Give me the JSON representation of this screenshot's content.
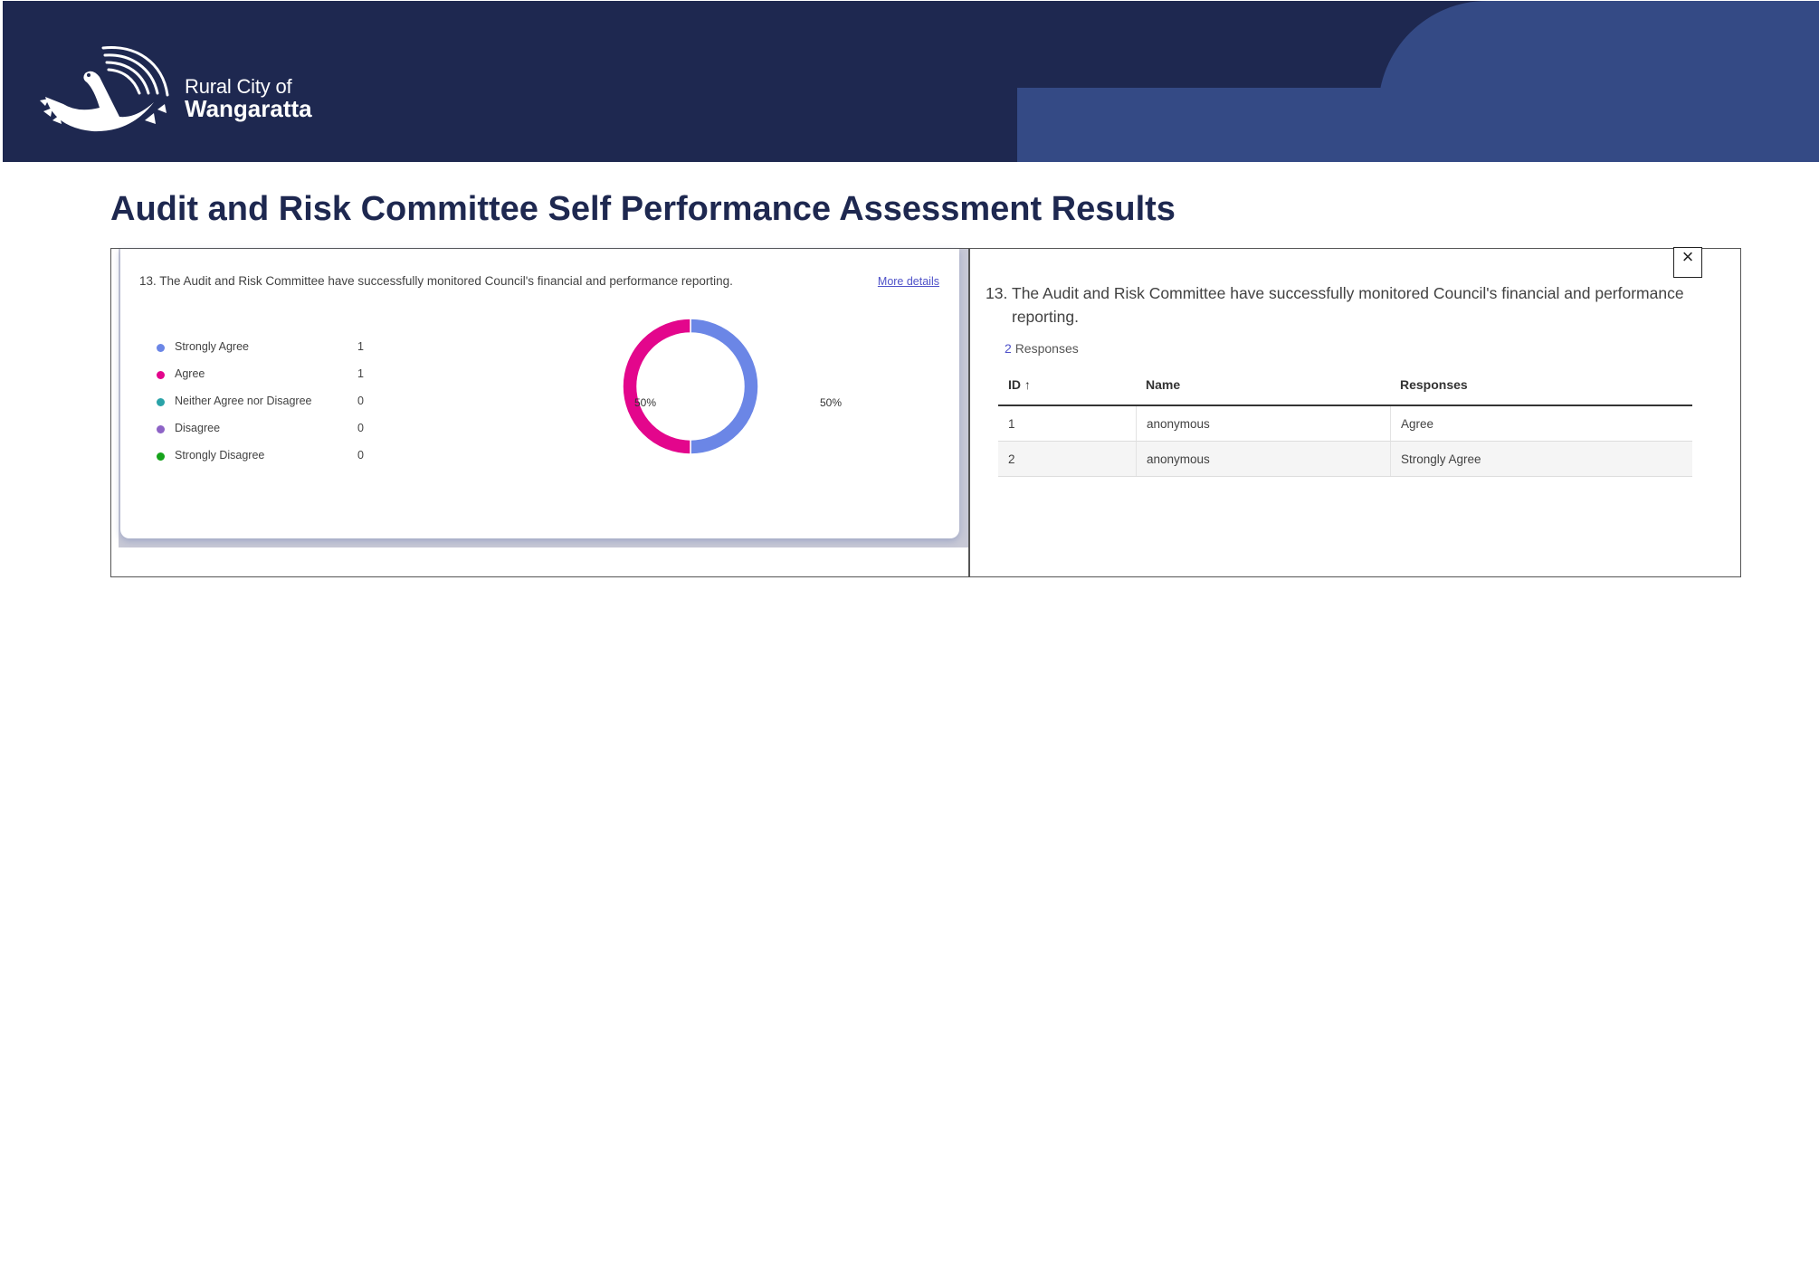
{
  "header": {
    "brand_line1": "Rural City of",
    "brand_line2": "Wangaratta"
  },
  "page_title": "Audit and Risk Committee Self Performance Assessment Results",
  "summary_card": {
    "question": "13. The Audit and Risk Committee have successfully monitored Council's financial and performance reporting.",
    "more_details_label": "More details",
    "legend": [
      {
        "label": "Strongly Agree",
        "count": "1",
        "color": "#6b86e6"
      },
      {
        "label": "Agree",
        "count": "1",
        "color": "#e3068c"
      },
      {
        "label": "Neither Agree nor Disagree",
        "count": "0",
        "color": "#2aa3a8"
      },
      {
        "label": "Disagree",
        "count": "0",
        "color": "#8d63c6"
      },
      {
        "label": "Strongly Disagree",
        "count": "0",
        "color": "#16a31b"
      }
    ]
  },
  "chart_data": {
    "type": "pie",
    "categories": [
      "Strongly Agree",
      "Agree",
      "Neither Agree nor Disagree",
      "Disagree",
      "Strongly Disagree"
    ],
    "values": [
      1,
      1,
      0,
      0,
      0
    ],
    "colors": [
      "#6b86e6",
      "#e3068c",
      "#2aa3a8",
      "#8d63c6",
      "#16a31b"
    ],
    "data_labels": {
      "left": "50%",
      "right": "50%"
    },
    "style": "donut"
  },
  "detail_panel": {
    "close_icon": "close-icon",
    "question_number": "13.",
    "question_text": "The Audit and Risk Committee have successfully monitored Council's financial and performance reporting.",
    "responses_count": "2",
    "responses_label": "Responses",
    "table": {
      "headers": {
        "id": "ID ↑",
        "name": "Name",
        "responses": "Responses"
      },
      "rows": [
        {
          "id": "1",
          "name": "anonymous",
          "response": "Agree"
        },
        {
          "id": "2",
          "name": "anonymous",
          "response": "Strongly Agree"
        }
      ]
    }
  }
}
